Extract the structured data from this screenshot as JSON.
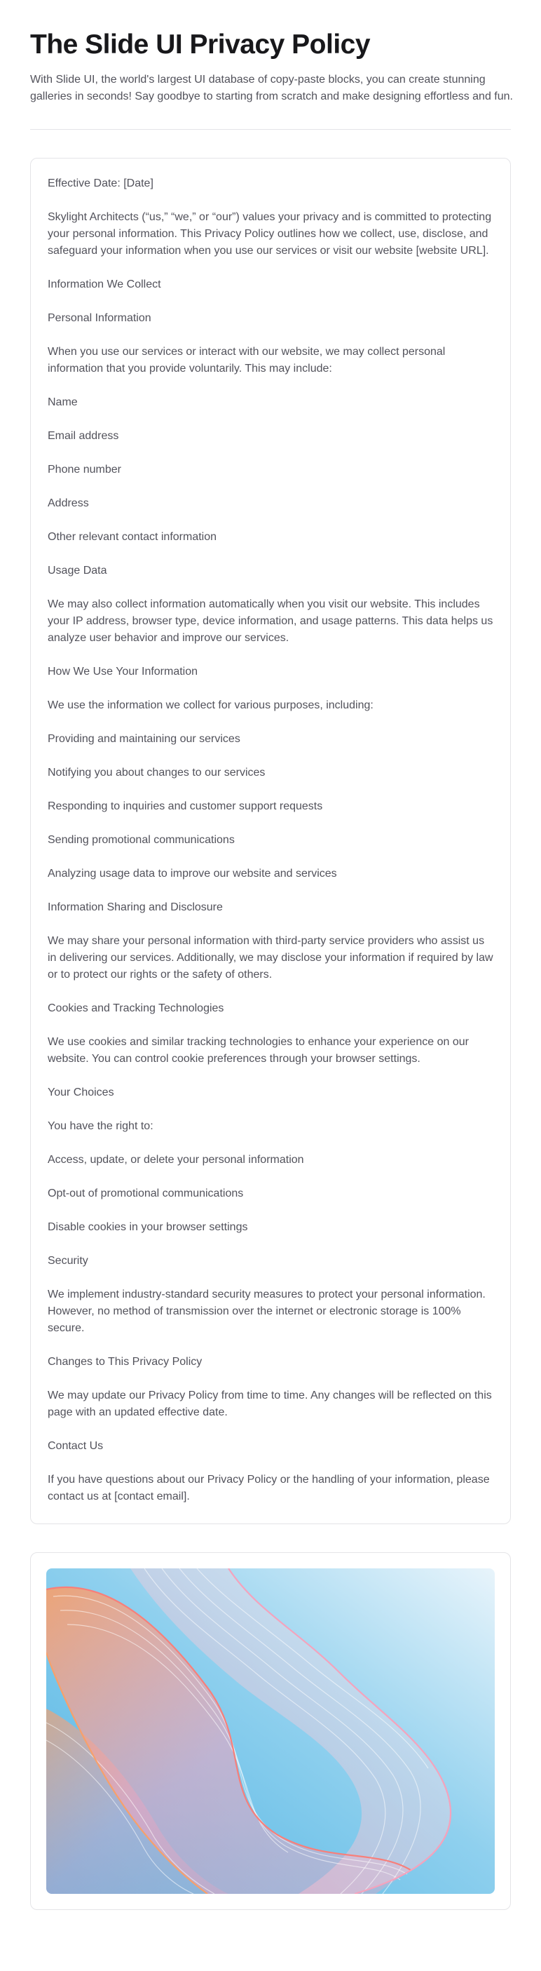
{
  "header": {
    "title": "The Slide UI Privacy Policy",
    "subtitle": "With Slide UI, the world's largest UI database of copy-paste blocks, you can create stunning galleries in seconds! Say goodbye to starting from scratch and make designing effortless and fun."
  },
  "policy": {
    "paragraphs": [
      "Effective Date: [Date]",
      "Skylight Architects (“us,” “we,” or “our”) values your privacy and is committed to protecting your personal information. This Privacy Policy outlines how we collect, use, disclose, and safeguard your information when you use our services or visit our website [website URL].",
      "Information We Collect",
      "Personal Information",
      "When you use our services or interact with our website, we may collect personal information that you provide voluntarily. This may include:",
      "Name",
      "Email address",
      "Phone number",
      "Address",
      "Other relevant contact information",
      "Usage Data",
      "We may also collect information automatically when you visit our website. This includes your IP address, browser type, device information, and usage patterns. This data helps us analyze user behavior and improve our services.",
      "How We Use Your Information",
      "We use the information we collect for various purposes, including:",
      "Providing and maintaining our services",
      "Notifying you about changes to our services",
      "Responding to inquiries and customer support requests",
      "Sending promotional communications",
      "Analyzing usage data to improve our website and services",
      "Information Sharing and Disclosure",
      "We may share your personal information with third-party service providers who assist us in delivering our services. Additionally, we may disclose your information if required by law or to protect our rights or the safety of others.",
      "Cookies and Tracking Technologies",
      "We use cookies and similar tracking technologies to enhance your experience on our website. You can control cookie preferences through your browser settings.",
      "Your Choices",
      "You have the right to:",
      "Access, update, or delete your personal information",
      "Opt-out of promotional communications",
      "Disable cookies in your browser settings",
      "Security",
      "We implement industry-standard security measures to protect your personal information. However, no method of transmission over the internet or electronic storage is 100% secure.",
      "Changes to This Privacy Policy",
      "We may update our Privacy Policy from time to time. Any changes will be reflected on this page with an updated effective date.",
      "Contact Us",
      "If you have questions about our Privacy Policy or the handling of your information, please contact us at [contact email]."
    ]
  },
  "colors": {
    "sky_light": "#e8f4fb",
    "sky_mid": "#8fd0ee",
    "sky_deep": "#4fb3e3",
    "ribbon_pink": "#f4a3bd",
    "ribbon_coral": "#f77f7a",
    "ribbon_orange": "#f7a06b"
  }
}
